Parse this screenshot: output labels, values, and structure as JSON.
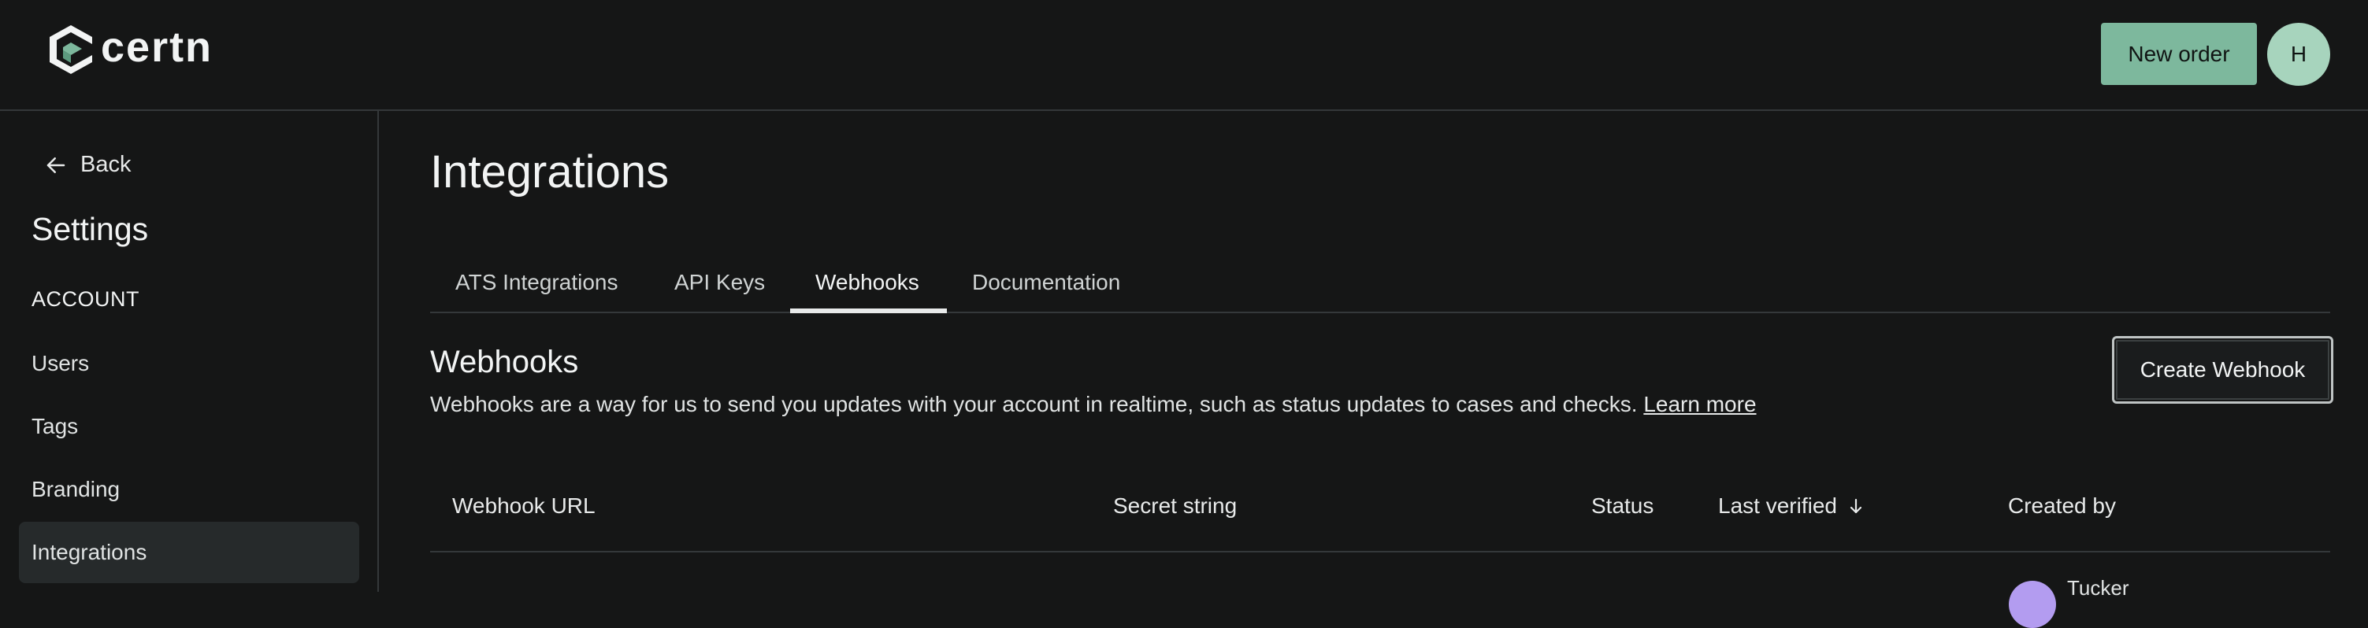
{
  "brand": {
    "name": "certn",
    "accent_color": "#7db89d"
  },
  "header": {
    "new_order_label": "New order",
    "avatar_initial": "H"
  },
  "sidebar": {
    "back_label": "Back",
    "title": "Settings",
    "section_label": "ACCOUNT",
    "items": [
      {
        "label": "Users",
        "active": false
      },
      {
        "label": "Tags",
        "active": false
      },
      {
        "label": "Branding",
        "active": false
      },
      {
        "label": "Integrations",
        "active": true
      }
    ]
  },
  "main": {
    "title": "Integrations",
    "tabs": [
      {
        "label": "ATS Integrations",
        "active": false
      },
      {
        "label": "API Keys",
        "active": false
      },
      {
        "label": "Webhooks",
        "active": true
      },
      {
        "label": "Documentation",
        "active": false
      }
    ],
    "webhooks": {
      "title": "Webhooks",
      "description": "Webhooks are a way for us to send you updates with your account in realtime, such as status updates to cases and checks.",
      "learn_more_label": "Learn more",
      "create_button_label": "Create Webhook"
    },
    "table": {
      "columns": [
        "Webhook URL",
        "Secret string",
        "Status",
        "Last verified",
        "Created by"
      ],
      "sorted_column": "Last verified",
      "sort_direction": "descending",
      "partial_row": {
        "creator_name": "Tucker"
      }
    }
  }
}
